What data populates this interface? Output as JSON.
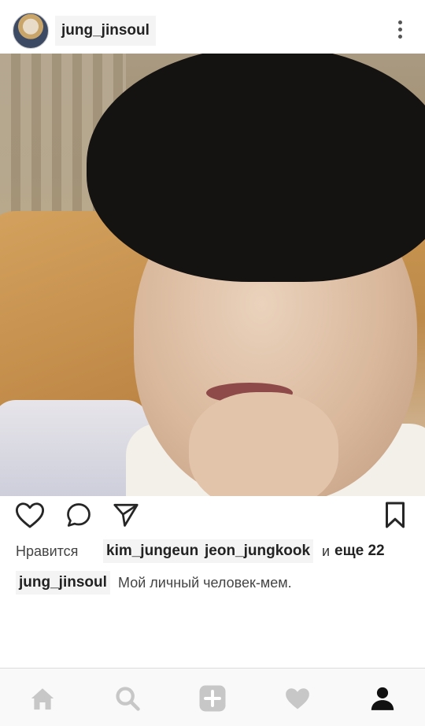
{
  "header": {
    "username": "jung_jinsoul"
  },
  "post": {
    "likes_prefix": "Нравится",
    "liked_by": [
      "kim_jungeun",
      "jeon_jungkook"
    ],
    "likes_and": "и",
    "likes_more": "еще 22",
    "caption_user": "jung_jinsoul",
    "caption_text": "Мой личный человек-мем."
  },
  "icons": {
    "header": [
      "avatar",
      "more-vertical-icon"
    ],
    "actions": [
      "heart-icon",
      "comment-icon",
      "send-icon",
      "bookmark-icon"
    ],
    "nav": [
      "home-icon",
      "search-icon",
      "add-icon",
      "heart-icon",
      "profile-icon"
    ]
  },
  "colors": {
    "icon_dark": "#262626",
    "icon_muted": "#c7c7c7",
    "chip_bg": "#f4f4f4"
  }
}
